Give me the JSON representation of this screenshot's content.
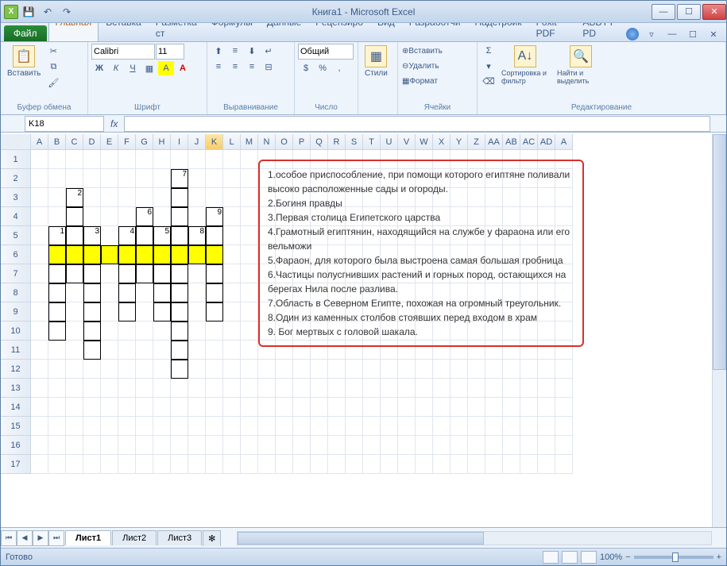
{
  "title": "Книга1 - Microsoft Excel",
  "qat": {
    "save": "💾",
    "undo": "↶",
    "redo": "↷"
  },
  "file_label": "Файл",
  "tabs": [
    "Главная",
    "Вставка",
    "Разметка ст",
    "Формулы",
    "Данные",
    "Рецензиро",
    "Вид",
    "Разработчи",
    "Надстройк",
    "Foxit PDF",
    "ABBYY PD"
  ],
  "active_tab": 0,
  "ribbon": {
    "clipboard": {
      "paste": "Вставить",
      "label": "Буфер обмена"
    },
    "font": {
      "name": "Calibri",
      "size": "11",
      "label": "Шрифт"
    },
    "align": {
      "label": "Выравнивание"
    },
    "number": {
      "format": "Общий",
      "label": "Число"
    },
    "styles": {
      "btn": "Стили",
      "label": ""
    },
    "cells": {
      "insert": "Вставить",
      "delete": "Удалить",
      "format": "Формат",
      "label": "Ячейки"
    },
    "editing": {
      "sort": "Сортировка и фильтр",
      "find": "Найти и выделить",
      "label": "Редактирование"
    }
  },
  "name_box": "K18",
  "columns": [
    "A",
    "B",
    "C",
    "D",
    "E",
    "F",
    "G",
    "H",
    "I",
    "J",
    "K",
    "L",
    "M",
    "N",
    "O",
    "P",
    "Q",
    "R",
    "S",
    "T",
    "U",
    "V",
    "W",
    "X",
    "Y",
    "Z",
    "AA",
    "AB",
    "AC",
    "AD",
    "A"
  ],
  "rows": [
    "1",
    "2",
    "3",
    "4",
    "5",
    "6",
    "7",
    "8",
    "9",
    "10",
    "11",
    "12",
    "13",
    "14",
    "15",
    "16",
    "17"
  ],
  "selected_col": "K",
  "crossword": {
    "numbers": [
      {
        "r": 2,
        "c": 9,
        "v": "7"
      },
      {
        "r": 3,
        "c": 3,
        "v": "2"
      },
      {
        "r": 4,
        "c": 7,
        "v": "6"
      },
      {
        "r": 4,
        "c": 11,
        "v": "9"
      },
      {
        "r": 5,
        "c": 2,
        "v": "1"
      },
      {
        "r": 5,
        "c": 4,
        "v": "3"
      },
      {
        "r": 5,
        "c": 6,
        "v": "4"
      },
      {
        "r": 5,
        "c": 8,
        "v": "5"
      },
      {
        "r": 5,
        "c": 10,
        "v": "8"
      }
    ],
    "cells": [
      {
        "r": 2,
        "c": 9
      },
      {
        "r": 3,
        "c": 3
      },
      {
        "r": 3,
        "c": 9
      },
      {
        "r": 4,
        "c": 3
      },
      {
        "r": 4,
        "c": 7
      },
      {
        "r": 4,
        "c": 9
      },
      {
        "r": 4,
        "c": 11
      },
      {
        "r": 5,
        "c": 2
      },
      {
        "r": 5,
        "c": 3
      },
      {
        "r": 5,
        "c": 4
      },
      {
        "r": 5,
        "c": 6
      },
      {
        "r": 5,
        "c": 7
      },
      {
        "r": 5,
        "c": 8
      },
      {
        "r": 5,
        "c": 9
      },
      {
        "r": 5,
        "c": 10
      },
      {
        "r": 5,
        "c": 11
      },
      {
        "r": 6,
        "c": 2,
        "y": 1
      },
      {
        "r": 6,
        "c": 3,
        "y": 1
      },
      {
        "r": 6,
        "c": 4,
        "y": 1
      },
      {
        "r": 6,
        "c": 5,
        "y": 1
      },
      {
        "r": 6,
        "c": 6,
        "y": 1
      },
      {
        "r": 6,
        "c": 7,
        "y": 1
      },
      {
        "r": 6,
        "c": 8,
        "y": 1
      },
      {
        "r": 6,
        "c": 9,
        "y": 1
      },
      {
        "r": 6,
        "c": 10,
        "y": 1
      },
      {
        "r": 6,
        "c": 11,
        "y": 1
      },
      {
        "r": 7,
        "c": 2
      },
      {
        "r": 7,
        "c": 3
      },
      {
        "r": 7,
        "c": 4
      },
      {
        "r": 7,
        "c": 6
      },
      {
        "r": 7,
        "c": 7
      },
      {
        "r": 7,
        "c": 8
      },
      {
        "r": 7,
        "c": 9
      },
      {
        "r": 7,
        "c": 11
      },
      {
        "r": 8,
        "c": 2
      },
      {
        "r": 8,
        "c": 4
      },
      {
        "r": 8,
        "c": 6
      },
      {
        "r": 8,
        "c": 8
      },
      {
        "r": 8,
        "c": 9
      },
      {
        "r": 8,
        "c": 11
      },
      {
        "r": 9,
        "c": 2
      },
      {
        "r": 9,
        "c": 4
      },
      {
        "r": 9,
        "c": 6
      },
      {
        "r": 9,
        "c": 8
      },
      {
        "r": 9,
        "c": 9
      },
      {
        "r": 9,
        "c": 11
      },
      {
        "r": 10,
        "c": 2
      },
      {
        "r": 10,
        "c": 4
      },
      {
        "r": 10,
        "c": 9
      },
      {
        "r": 11,
        "c": 4
      },
      {
        "r": 11,
        "c": 9
      },
      {
        "r": 12,
        "c": 9
      }
    ]
  },
  "clues": [
    "1.особое приспособление, при помощи которого египтяне поливали высоко расположенные сады и огороды.",
    "2.Богиня правды",
    "3.Первая столица Египетского царства",
    "4.Грамотный египтянин, находящийся на службе у фараона или его вельможи",
    "5.Фараон, для которого была выстроена самая большая гробница",
    "6.Частицы полусгнивших растений и горных пород, остающихся на берегах Нила после разлива.",
    "7.Область в Северном Египте, похожая на огромный треугольник.",
    "8.Один из каменных столбов стоявших перед входом в храм",
    "9. Бог мертвых с головой шакала."
  ],
  "sheets": [
    "Лист1",
    "Лист2",
    "Лист3"
  ],
  "active_sheet": 0,
  "status": "Готово",
  "zoom": "100%"
}
